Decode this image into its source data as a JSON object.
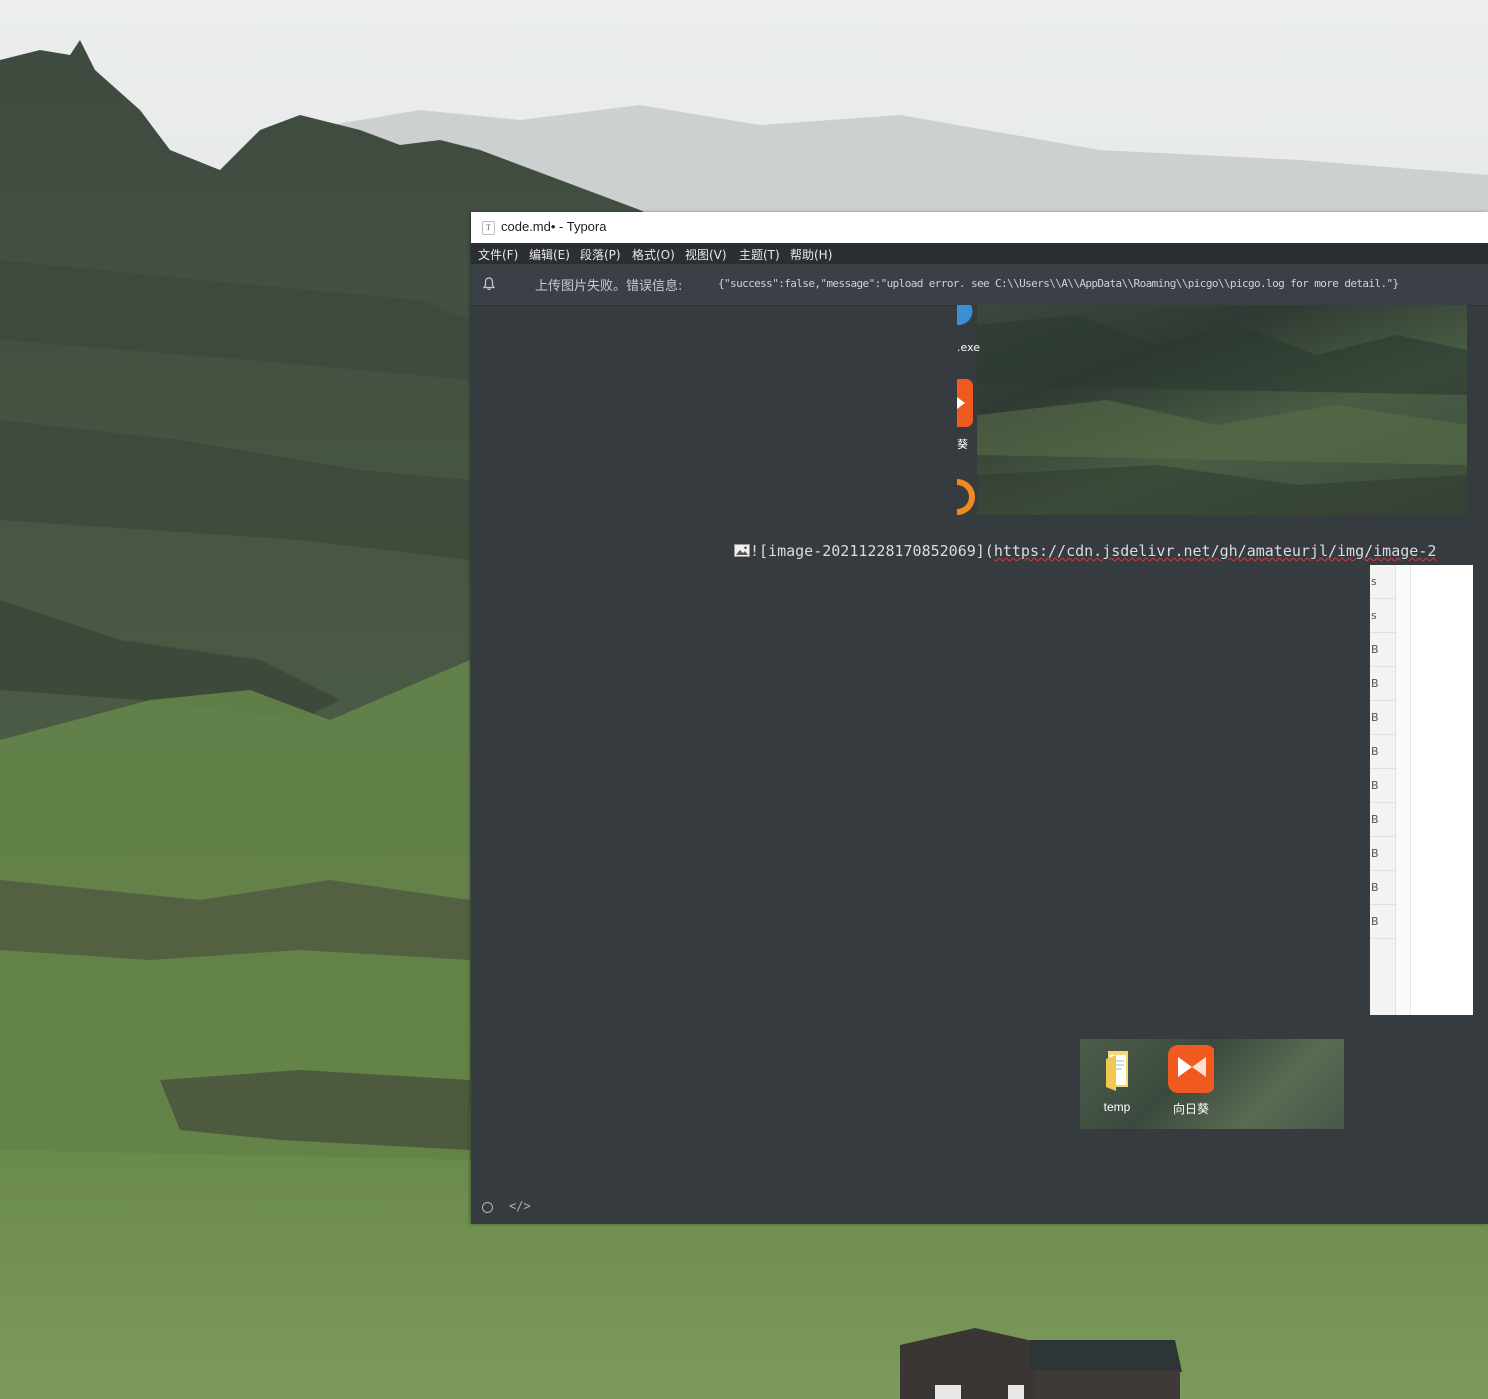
{
  "window": {
    "title": "code.md• - Typora",
    "app_icon": "T"
  },
  "menu": [
    {
      "label": "文件(F)"
    },
    {
      "label": "编辑(E)"
    },
    {
      "label": "段落(P)"
    },
    {
      "label": "格式(O)"
    },
    {
      "label": "视图(V)"
    },
    {
      "label": "主题(T)"
    },
    {
      "label": "帮助(H)"
    }
  ],
  "notification": {
    "icon": "bell-icon",
    "label": "上传图片失败。错误信息:",
    "message": "{\"success\":false,\"message\":\"upload error. see C:\\\\Users\\\\A\\\\AppData\\\\Roaming\\\\picgo\\\\picgo.log for more detail.\"}"
  },
  "editor": {
    "markdown_prefix": "![image-20211228170852069](",
    "markdown_url": "https://cdn.jsdelivr.net/gh/amateurjl/img/image-2",
    "embedded_top": {
      "exe_label": ".exe",
      "sunlogin_label": "葵"
    },
    "embedded_right": {
      "rows": [
        "s",
        "s",
        "B",
        "B",
        "B",
        "B",
        "B",
        "B",
        "B",
        "B",
        "B"
      ]
    },
    "embedded_desktop": {
      "icons": [
        {
          "label": "temp",
          "icon": "folder-icon"
        },
        {
          "label": "向日葵",
          "icon": "sunlogin-icon"
        }
      ]
    }
  },
  "statusbar": {
    "source_toggle": "</>"
  },
  "colors": {
    "editor_bg": "#363b40",
    "menubar_bg": "#2b2f33",
    "notice_bg": "#3b4046",
    "sunlogin_orange": "#f05a1e",
    "spellcheck_underline": "#d23b3b"
  }
}
